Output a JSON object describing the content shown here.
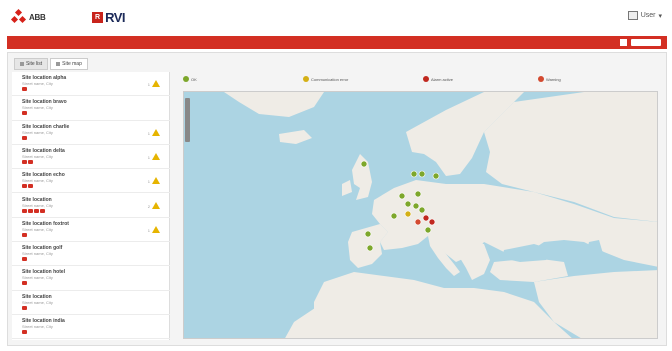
{
  "header": {
    "brand_text": "ABB",
    "logo_box": "R",
    "logo_text": "RVI",
    "user_label": "User"
  },
  "tabs": [
    {
      "label": "Site list",
      "active": false
    },
    {
      "label": "Site map",
      "active": true
    }
  ],
  "sites": [
    {
      "name": "Site location alpha",
      "sub": "Street name, City",
      "dots": 1,
      "warn": true,
      "warn_num": "1"
    },
    {
      "name": "Site location bravo",
      "sub": "Street name, City",
      "dots": 1,
      "warn": false
    },
    {
      "name": "Site location charlie",
      "sub": "Street name, City",
      "dots": 1,
      "warn": true,
      "warn_num": "1"
    },
    {
      "name": "Site location delta",
      "sub": "Street name, City",
      "dots": 2,
      "warn": true,
      "warn_num": "1"
    },
    {
      "name": "Site location echo",
      "sub": "Street name, City",
      "dots": 2,
      "warn": true,
      "warn_num": "1"
    },
    {
      "name": "Site location",
      "sub": "Street name, City",
      "dots": 4,
      "warn": true,
      "warn_num": "2"
    },
    {
      "name": "Site location foxtrot",
      "sub": "Street name, City",
      "dots": 1,
      "warn": true,
      "warn_num": "1"
    },
    {
      "name": "Site location golf",
      "sub": "Street name, City",
      "dots": 1,
      "warn": false
    },
    {
      "name": "Site location hotel",
      "sub": "Street name, City",
      "dots": 1,
      "warn": false
    },
    {
      "name": "Site location",
      "sub": "Street name, City",
      "dots": 1,
      "warn": false
    },
    {
      "name": "Site location india",
      "sub": "Street name, City",
      "dots": 1,
      "warn": false
    }
  ],
  "legend": [
    {
      "label": "OK",
      "color": "#7da72b"
    },
    {
      "label": "Communication error",
      "color": "#d4b016"
    },
    {
      "label": "Alarm active",
      "color": "#c0281f"
    },
    {
      "label": "Warning",
      "color": "#d34a30"
    }
  ],
  "colors": {
    "accent_red": "#d32f23",
    "warn_yellow": "#e6b400",
    "sea": "#acd4e3",
    "land": "#efece6"
  }
}
